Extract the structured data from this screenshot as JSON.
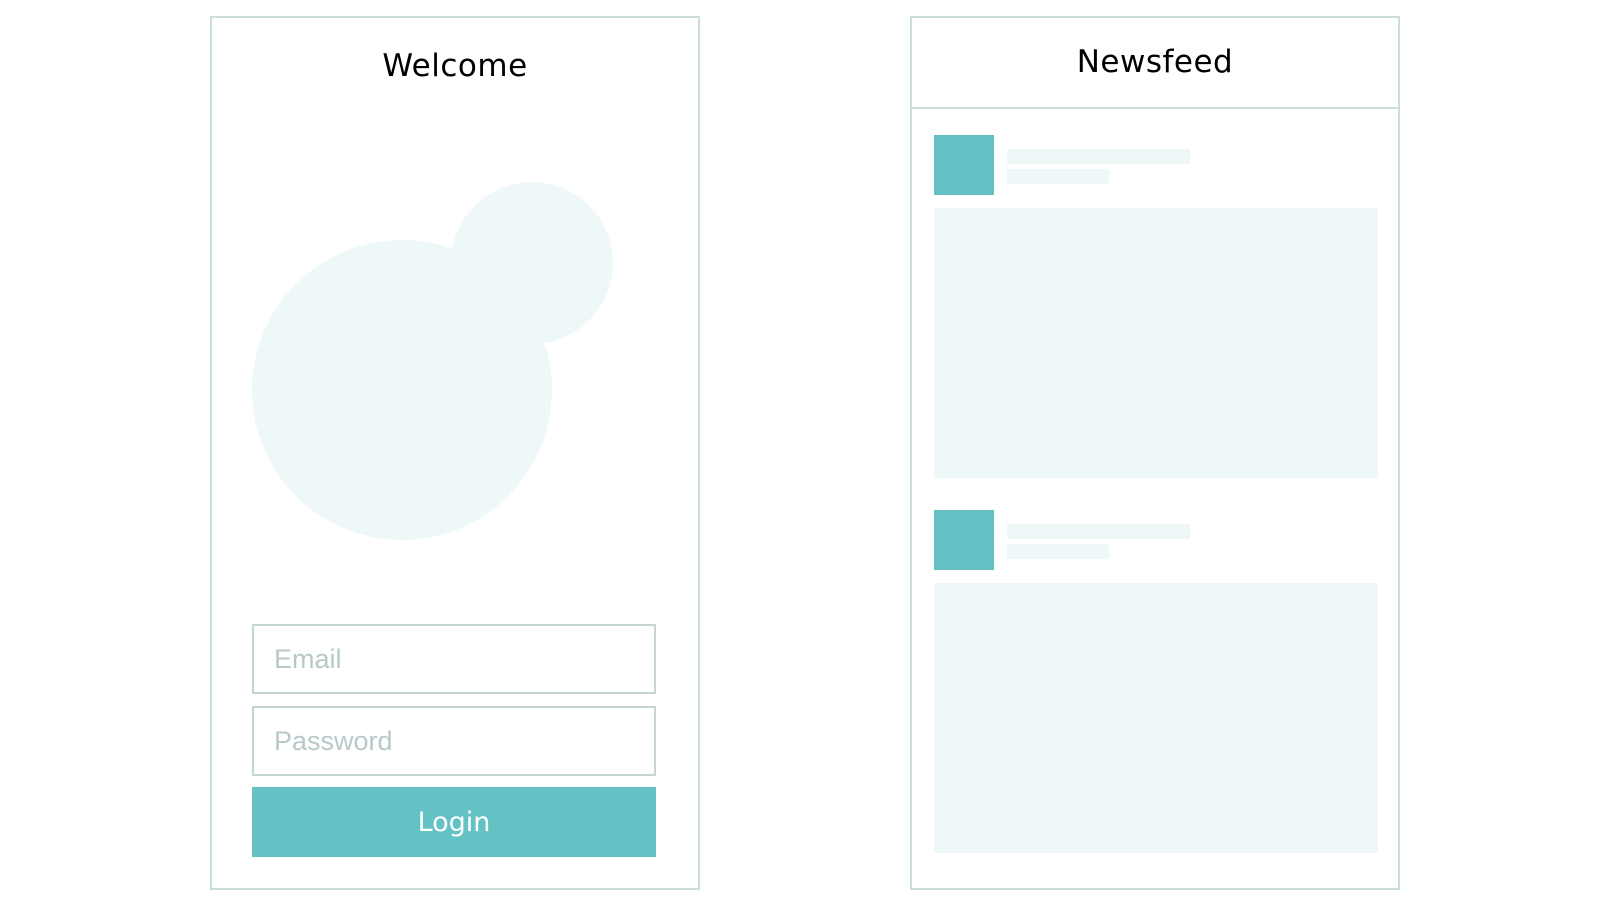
{
  "welcome": {
    "title": "Welcome",
    "email_placeholder": "Email",
    "password_placeholder": "Password",
    "login_label": "Login"
  },
  "newsfeed": {
    "title": "Newsfeed",
    "posts": [
      {
        "avatar": "avatar-placeholder",
        "media": "image-placeholder"
      },
      {
        "avatar": "avatar-placeholder",
        "media": "image-placeholder"
      }
    ]
  },
  "colors": {
    "accent": "#62c2c4",
    "placeholder_fill": "#eff8f8",
    "border": "#ccdddd",
    "field_text": "#b7c9c9"
  }
}
